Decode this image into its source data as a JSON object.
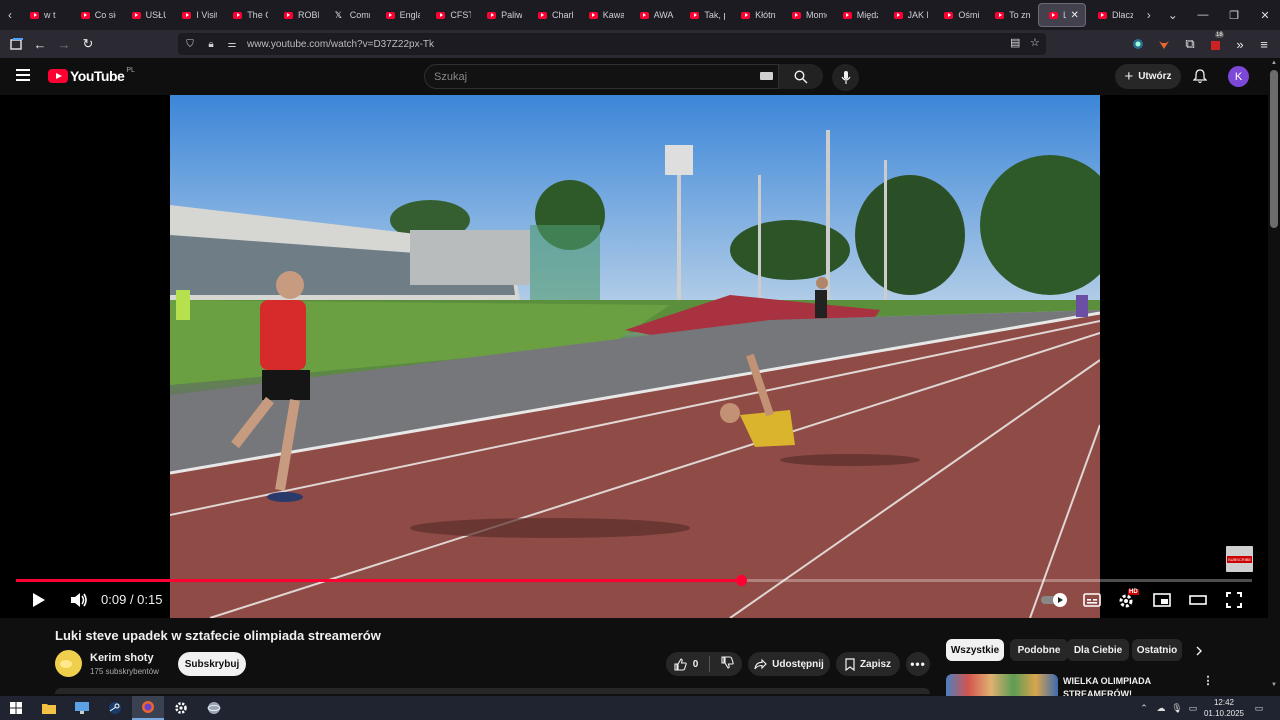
{
  "browser": {
    "tabs": [
      {
        "label": "w t",
        "icon": "yt-favicon"
      },
      {
        "label": "Co się",
        "icon": "yt-favicon"
      },
      {
        "label": "USŁUG",
        "icon": "yt-favicon"
      },
      {
        "label": "I Visit",
        "icon": "yt-favicon"
      },
      {
        "label": "The G",
        "icon": "yt-favicon"
      },
      {
        "label": "ROBIŁ",
        "icon": "yt-favicon"
      },
      {
        "label": "Comm",
        "icon": "x-favicon"
      },
      {
        "label": "Englan",
        "icon": "yt-favicon"
      },
      {
        "label": "CFSTV",
        "icon": "yt-favicon"
      },
      {
        "label": "Paliwo",
        "icon": "yt-favicon"
      },
      {
        "label": "Charlie",
        "icon": "yt-favicon"
      },
      {
        "label": "Kawał",
        "icon": "yt-favicon"
      },
      {
        "label": "AWAN",
        "icon": "yt-favicon"
      },
      {
        "label": "Tak, p",
        "icon": "yt-favicon"
      },
      {
        "label": "Kłótni",
        "icon": "yt-favicon"
      },
      {
        "label": "Mome",
        "icon": "yt-favicon"
      },
      {
        "label": "Międz",
        "icon": "yt-favicon"
      },
      {
        "label": "JAK BY",
        "icon": "yt-favicon"
      },
      {
        "label": "Ośmie",
        "icon": "yt-favicon"
      },
      {
        "label": "To zm",
        "icon": "yt-favicon"
      },
      {
        "label": "Luk",
        "icon": "yt-favicon",
        "active": true
      },
      {
        "label": "Dlacz",
        "icon": "yt-favicon"
      }
    ],
    "url": "www.youtube.com/watch?v=D37Z22px-Tk",
    "notification_badge": "18"
  },
  "youtube": {
    "logo_text": "YouTube",
    "country_code": "PL",
    "search_placeholder": "Szukaj",
    "create_label": "Utwórz",
    "avatar_letter": "K"
  },
  "player": {
    "time_current": "0:09",
    "time_total": "0:15",
    "progress": 0.5867,
    "hd_badge": "HD",
    "watermark_text": "SUBSCRIBE"
  },
  "video": {
    "title": "Luki steve upadek w sztafecie olimpiada streamerów",
    "channel_name": "Kerim shoty",
    "subscribers": "175 subskrybentów",
    "subscribe_label": "Subskrybuj",
    "like_count": "0",
    "share_label": "Udostępnij",
    "save_label": "Zapisz"
  },
  "sidebar": {
    "chips": [
      {
        "label": "Wszystkie",
        "active": true
      },
      {
        "label": "Podobne",
        "active": false
      },
      {
        "label": "Dla Ciebie",
        "active": false
      },
      {
        "label": "Ostatnio",
        "active": false
      }
    ],
    "recommended": [
      {
        "title": "WIELKA OLIMPIADA STREAMERÓW!"
      }
    ]
  },
  "taskbar": {
    "time": "12:42",
    "date": "01.10.2025"
  },
  "colors": {
    "yt_red": "#ff0033",
    "bg": "#0f0f0f",
    "avatar": "#7d48d7"
  }
}
